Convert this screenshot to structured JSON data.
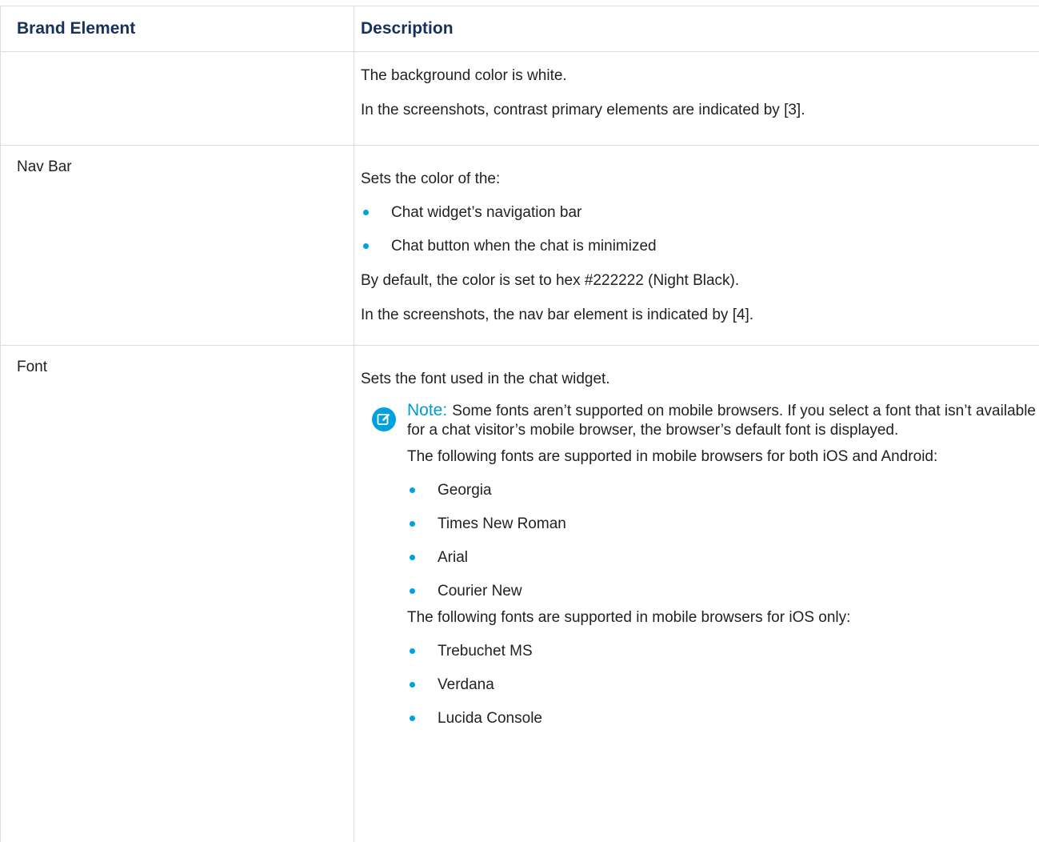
{
  "table": {
    "headers": [
      "Brand Element",
      "Description"
    ],
    "rows": [
      {
        "element": "",
        "paragraphs": [
          "The background color is white.",
          "In the screenshots, contrast primary elements are indicated by [3]."
        ]
      },
      {
        "element": "Nav Bar",
        "intro": "Sets the color of the:",
        "bullets": [
          "Chat widget’s navigation bar",
          "Chat button when the chat is minimized"
        ],
        "paragraphs": [
          "By default, the color is set to hex #222222 (Night Black).",
          "In the screenshots, the nav bar element is indicated by [4]."
        ]
      },
      {
        "element": "Font",
        "intro": "Sets the font used in the chat widget.",
        "note": {
          "label": "Note:",
          "text": "Some fonts aren’t supported on mobile browsers. If you select a font that isn’t available for a chat visitor’s mobile browser, the browser’s default font is displayed.",
          "both_intro": "The following fonts are supported in mobile browsers for both iOS and Android:",
          "both_fonts": [
            "Georgia",
            "Times New Roman",
            "Arial",
            "Courier New"
          ],
          "ios_intro": "The following fonts are supported in mobile browsers for iOS only:",
          "ios_fonts": [
            "Trebuchet MS",
            "Verdana",
            "Lucida Console"
          ]
        }
      }
    ]
  },
  "colors": {
    "header_text": "#16325c",
    "bullet": "#00a1e0",
    "note_label": "#0099d8",
    "border": "#d8dde6"
  },
  "icons": {
    "note": "edit-note-icon"
  }
}
